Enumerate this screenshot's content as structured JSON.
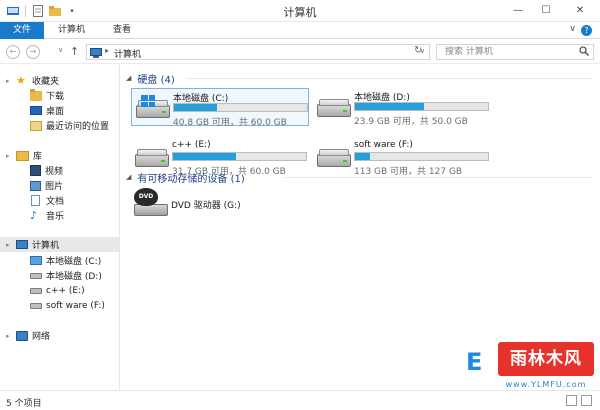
{
  "window": {
    "title": "计算机"
  },
  "ribbon": {
    "tabs": [
      "文件",
      "计算机",
      "查看"
    ],
    "help_glyph": "?",
    "expand_glyph": "∨"
  },
  "window_controls": {
    "minimize": "—",
    "maximize": "☐",
    "close": "✕"
  },
  "address": {
    "breadcrumb_sep": "▸",
    "crumb": "计算机",
    "dropdown_glyph": "∨",
    "refresh_glyph": "↻"
  },
  "nav": {
    "back": "←",
    "forward": "→",
    "history": "∨",
    "up": "↑"
  },
  "search": {
    "placeholder": "搜索 计算机",
    "icon": "search-icon"
  },
  "sidebar": {
    "favorites": {
      "label": "收藏夹",
      "items": [
        "下载",
        "桌面",
        "最近访问的位置"
      ]
    },
    "libraries": {
      "label": "库",
      "items": [
        "视频",
        "图片",
        "文档",
        "音乐"
      ]
    },
    "computer": {
      "label": "计算机",
      "items": [
        "本地磁盘 (C:)",
        "本地磁盘 (D:)",
        "c++ (E:)",
        "soft ware (F:)"
      ]
    },
    "network": {
      "label": "网络"
    }
  },
  "groups": {
    "hard_disks": {
      "label": "硬盘 (4)"
    },
    "removable": {
      "label": "有可移动存储的设备 (1)"
    }
  },
  "drives": [
    {
      "name": "本地磁盘 (C:)",
      "info": "40.8 GB 可用，共 60.0 GB",
      "used_fraction": 0.32,
      "system": true
    },
    {
      "name": "本地磁盘 (D:)",
      "info": "23.9 GB 可用，共 50.0 GB",
      "used_fraction": 0.52,
      "system": false
    },
    {
      "name": "c++ (E:)",
      "info": "31.7 GB 可用，共 60.0 GB",
      "used_fraction": 0.47,
      "system": false
    },
    {
      "name": "soft ware (F:)",
      "info": "113 GB 可用，共 127 GB",
      "used_fraction": 0.11,
      "system": false
    }
  ],
  "dvd": {
    "name": "DVD 驱动器 (G:)",
    "label": "DVD"
  },
  "status": {
    "count": "5 个项目"
  },
  "watermark": {
    "logo": "E",
    "site": "雨林木风",
    "url": "www.YLMFU.com"
  },
  "colors": {
    "accent": "#1979ca",
    "bar_fill": "#26a0da",
    "group_heading": "#1e3f8a"
  }
}
